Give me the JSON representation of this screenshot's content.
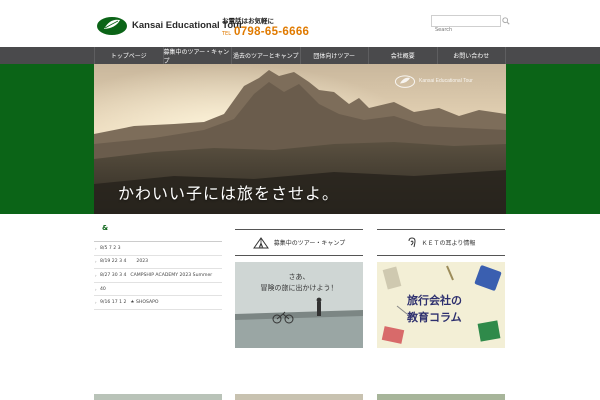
{
  "header": {
    "logo_text": "Kansai Educational Tour",
    "phone_note": "お電話はお気軽に",
    "phone_label": "TEL",
    "phone_number": "0798-65-6666",
    "search_placeholder": "Search"
  },
  "nav": {
    "items": [
      {
        "label": "トップページ"
      },
      {
        "label": "募集中のツアー・キャンプ"
      },
      {
        "label": "過去のツアーとキャンプ"
      },
      {
        "label": "団体向けツアー"
      },
      {
        "label": "会社概要"
      },
      {
        "label": "お問い合わせ"
      }
    ]
  },
  "hero": {
    "caption": "かわいい子には旅をさせよ。",
    "logo_text": "Kansai Educational Tour"
  },
  "news": {
    "title": "&",
    "items": [
      {
        "date": "8/5 7 2 3",
        "text": ""
      },
      {
        "date": "8/19 22 3 4",
        "text": "2023"
      },
      {
        "date": "8/27 30 3 4",
        "text": "CAMPSHIP ACADEMY 2023 Summer"
      },
      {
        "date": "40",
        "text": ""
      },
      {
        "date": "9/16 17 1 2",
        "text": "★  SHOSAPO"
      }
    ]
  },
  "tours": {
    "heading": "募集中のツアー・キャンプ",
    "line1": "さあ、",
    "line2": "冒険の旅に出かけよう！"
  },
  "column": {
    "heading": "ＫＥＴの耳より情報",
    "line1": "旅行会社の",
    "line2": "教育コラム"
  },
  "colors": {
    "green": "#0b6417",
    "nav": "#4a4a4c",
    "phone": "#e07a00"
  }
}
